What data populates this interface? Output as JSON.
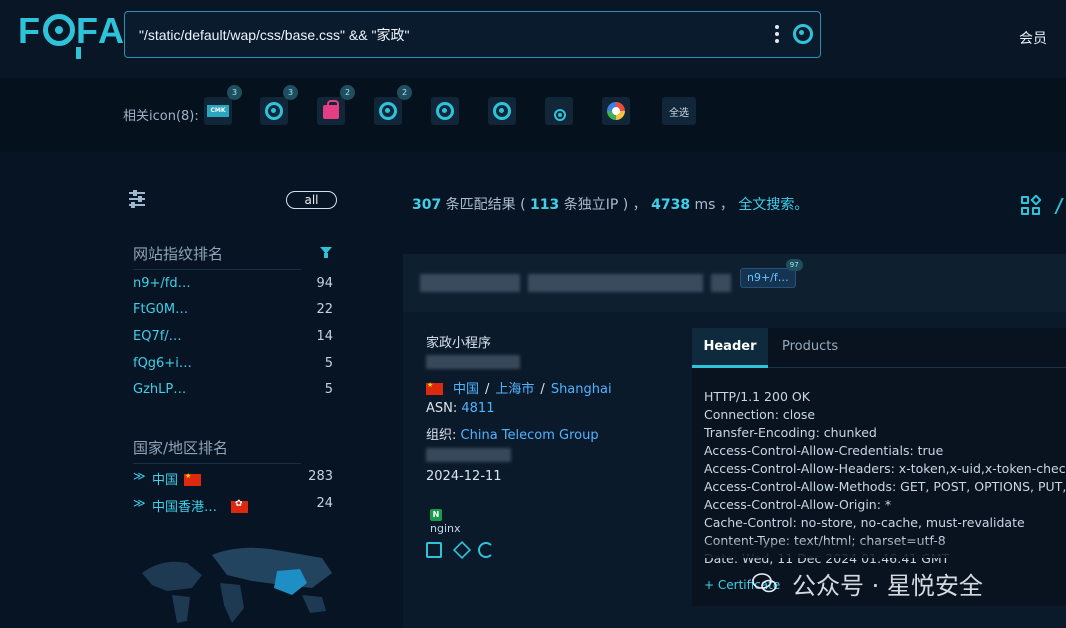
{
  "header": {
    "logo": "FOFA",
    "query": "\"/static/default/wap/css/base.css\" && \"家政\"",
    "member_label": "会员"
  },
  "related_icons": {
    "label": "相关icon(8):",
    "items": [
      {
        "name": "cmk-icon",
        "text": "CMK",
        "badge": "3"
      },
      {
        "name": "fofa-q-icon",
        "text": "",
        "badge": "3"
      },
      {
        "name": "shopping-bag-icon",
        "text": "",
        "badge": "2"
      },
      {
        "name": "fofa-q-icon",
        "text": "",
        "badge": "2"
      },
      {
        "name": "fofa-q-icon",
        "text": "",
        "badge": ""
      },
      {
        "name": "fofa-q-icon",
        "text": "",
        "badge": ""
      },
      {
        "name": "target-ring-icon",
        "text": "",
        "badge": ""
      },
      {
        "name": "colorful-pinwheel-icon",
        "text": "",
        "badge": ""
      }
    ],
    "select_all": "全选"
  },
  "sidebar": {
    "all_label": "all",
    "fingerprint_title": "网站指纹排名",
    "fingerprints": [
      {
        "label": "n9+/fd…",
        "count": "94"
      },
      {
        "label": "FtG0M…",
        "count": "22"
      },
      {
        "label": "EQ7f/…",
        "count": "14"
      },
      {
        "label": "fQg6+i…",
        "count": "5"
      },
      {
        "label": "GzhLP…",
        "count": "5"
      }
    ],
    "country_title": "国家/地区排名",
    "countries": [
      {
        "label": "中国",
        "count": "283",
        "flag": "cn"
      },
      {
        "label": "中国香港…",
        "count": "24",
        "flag": "hk"
      }
    ]
  },
  "stats": {
    "matches": "307",
    "matches_text": " 条匹配结果 ( ",
    "ips": "113",
    "ips_text": " 条独立IP ) ， ",
    "ms": "4738",
    "ms_text": " ms ， ",
    "fulltext": "全文搜索。"
  },
  "result": {
    "tag": "n9+/f…",
    "tag_count": "97",
    "title": "家政小程序",
    "country": "中国",
    "city": "上海市",
    "city_en": "Shanghai",
    "asn_label": "ASN:",
    "asn": "4811",
    "org_label": "组织:",
    "org": "China Telecom Group",
    "date": "2024-12-11",
    "server": "nginx"
  },
  "panel": {
    "tab_header": "Header",
    "tab_products": "Products",
    "headers": [
      "HTTP/1.1 200 OK",
      "Connection: close",
      "Transfer-Encoding: chunked",
      "Access-Control-Allow-Credentials: true",
      "Access-Control-Allow-Headers: x-token,x-uid,x-token-check,x-",
      "Access-Control-Allow-Methods: GET, POST, OPTIONS, PUT,",
      "Access-Control-Allow-Origin: *",
      "Cache-Control: no-store, no-cache, must-revalidate",
      "Content-Type: text/html; charset=utf-8",
      "Date: Wed, 11 Dec 2024 01:46:41 GMT"
    ],
    "certificate": "+ Certificate"
  },
  "watermark": "公众号 · 星悦安全"
}
